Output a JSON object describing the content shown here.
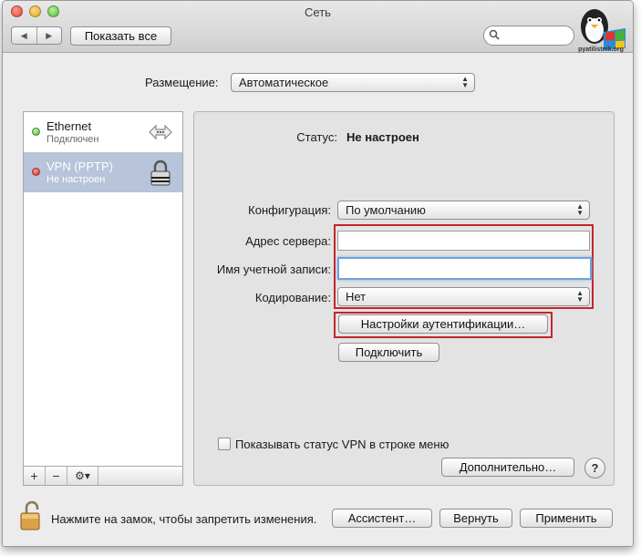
{
  "window": {
    "title": "Сеть",
    "show_all_label": "Показать все",
    "search_placeholder": "",
    "logo_text": "pyatilistnik.org",
    "nav_back": "◀",
    "nav_forward": "▶"
  },
  "location": {
    "label": "Размещение:",
    "value": "Автоматическое"
  },
  "sidebar": {
    "items": [
      {
        "name": "Ethernet",
        "status": "Подключен",
        "indicator_color": "#3cb42f",
        "icon": "ethernet-icon"
      },
      {
        "name": "VPN (PPTP)",
        "status": "Не настроен",
        "indicator_color": "#d0231b",
        "icon": "lock-icon",
        "selected": true
      }
    ],
    "add_label": "+",
    "remove_label": "−",
    "gear_label": "⚙▾"
  },
  "panel": {
    "status_label": "Статус:",
    "status_value": "Не настроен",
    "config_label": "Конфигурация:",
    "config_value": "По умолчанию",
    "server_label": "Адрес сервера:",
    "server_value": "",
    "account_label": "Имя учетной записи:",
    "account_value": "",
    "encryption_label": "Кодирование:",
    "encryption_value": "Нет",
    "auth_button": "Настройки аутентификации…",
    "connect_button": "Подключить",
    "show_vpn_status_label": "Показывать статус VPN в строке меню",
    "advanced_button": "Дополнительно…",
    "help_label": "?"
  },
  "footer": {
    "lock_text": "Нажмите на замок, чтобы запретить изменения.",
    "assistant_button": "Ассистент…",
    "revert_button": "Вернуть",
    "apply_button": "Применить"
  },
  "colors": {
    "selection": "#b7c4d9",
    "highlight_box": "#c4252b",
    "focus_ring": "#6ea4dd"
  }
}
